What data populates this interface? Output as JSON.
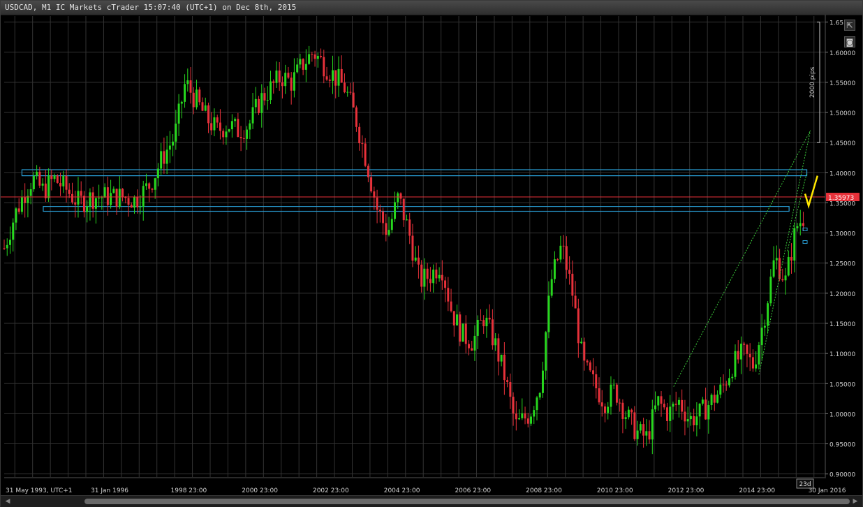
{
  "window": {
    "title": "USDCAD, M1 IC Markets cTrader 15:07:40 (UTC+1) on Dec 8th, 2015"
  },
  "toolbar": {
    "expand_icon": "expand-icon",
    "screenshot_icon": "camera-icon"
  },
  "chart_data": {
    "type": "candlestick",
    "title": "USDCAD, M1 IC Markets cTrader 15:07:40 (UTC+1) on Dec 8th, 2015",
    "ylim": [
      0.895,
      1.66
    ],
    "grid": true,
    "y_ticks": [
      "0.90000",
      "0.95000",
      "1.00000",
      "1.05000",
      "1.10000",
      "1.15000",
      "1.20000",
      "1.25000",
      "1.30000",
      "1.35000",
      "1.40000",
      "1.45000",
      "1.50000",
      "1.55000",
      "1.60000",
      "1.65"
    ],
    "x_ticks": [
      "31 May 1993, UTC+1",
      "31 Jan 1996",
      "1998 23:00",
      "2000 23:00",
      "2002 23:00",
      "2004 23:00",
      "2006 23:00",
      "2008 23:00",
      "2010 23:00",
      "2012 23:00",
      "2014 23:00",
      "30 Jan 2016"
    ],
    "current_price": {
      "label": "1.35973",
      "value": 1.35973,
      "color": "#e8313a"
    },
    "pip_ruler": {
      "label": "2000 pips",
      "from": 1.45,
      "to": 1.65
    },
    "period_label": "23d",
    "colors": {
      "up": "#27d81e",
      "down": "#e8313a",
      "zone": "#2a9fd6",
      "channel": "#3ccf3c",
      "projection": "#ffe600",
      "grid": "#333333",
      "axis_text": "#cfcfcf"
    },
    "zones": [
      {
        "start": "1993.9",
        "end": "2016.0",
        "top": 1.405,
        "bottom": 1.395
      },
      {
        "start": "1994.5",
        "end": "2015.5",
        "top": 1.344,
        "bottom": 1.336
      }
    ],
    "price_path": [
      [
        "1993.4",
        1.275
      ],
      [
        "1993.7",
        1.33
      ],
      [
        "1994.0",
        1.37
      ],
      [
        "1994.2",
        1.39
      ],
      [
        "1994.5",
        1.37
      ],
      [
        "1994.8",
        1.39
      ],
      [
        "1995.1",
        1.375
      ],
      [
        "1995.5",
        1.35
      ],
      [
        "1995.9",
        1.36
      ],
      [
        "1996.3",
        1.36
      ],
      [
        "1996.7",
        1.36
      ],
      [
        "1997.1",
        1.355
      ],
      [
        "1997.5",
        1.38
      ],
      [
        "1997.9",
        1.43
      ],
      [
        "1998.2",
        1.46
      ],
      [
        "1998.5",
        1.55
      ],
      [
        "1998.8",
        1.52
      ],
      [
        "1999.1",
        1.49
      ],
      [
        "1999.4",
        1.47
      ],
      [
        "1999.7",
        1.48
      ],
      [
        "2000.0",
        1.47
      ],
      [
        "2000.3",
        1.48
      ],
      [
        "2000.6",
        1.52
      ],
      [
        "2000.9",
        1.54
      ],
      [
        "2001.2",
        1.56
      ],
      [
        "2001.5",
        1.55
      ],
      [
        "2001.8",
        1.58
      ],
      [
        "2002.1",
        1.6
      ],
      [
        "2002.4",
        1.58
      ],
      [
        "2002.7",
        1.56
      ],
      [
        "2003.0",
        1.54
      ],
      [
        "2003.3",
        1.49
      ],
      [
        "2003.6",
        1.42
      ],
      [
        "2003.9",
        1.34
      ],
      [
        "2004.2",
        1.3
      ],
      [
        "2004.5",
        1.36
      ],
      [
        "2004.8",
        1.3
      ],
      [
        "2005.1",
        1.22
      ],
      [
        "2005.4",
        1.23
      ],
      [
        "2005.7",
        1.25
      ],
      [
        "2006.0",
        1.17
      ],
      [
        "2006.3",
        1.13
      ],
      [
        "2006.6",
        1.12
      ],
      [
        "2006.9",
        1.16
      ],
      [
        "2007.2",
        1.12
      ],
      [
        "2007.5",
        1.06
      ],
      [
        "2007.8",
        0.98
      ],
      [
        "2008.2",
        1.0
      ],
      [
        "2008.5",
        1.05
      ],
      [
        "2008.8",
        1.22
      ],
      [
        "2009.1",
        1.28
      ],
      [
        "2009.4",
        1.2
      ],
      [
        "2009.7",
        1.08
      ],
      [
        "2010.0",
        1.05
      ],
      [
        "2010.3",
        1.02
      ],
      [
        "2010.6",
        1.04
      ],
      [
        "2010.9",
        1.0
      ],
      [
        "2011.2",
        0.97
      ],
      [
        "2011.5",
        0.96
      ],
      [
        "2011.8",
        1.02
      ],
      [
        "2012.1",
        1.0
      ],
      [
        "2012.4",
        1.02
      ],
      [
        "2012.7",
        0.99
      ],
      [
        "2013.0",
        1.0
      ],
      [
        "2013.3",
        1.02
      ],
      [
        "2013.6",
        1.04
      ],
      [
        "2013.9",
        1.08
      ],
      [
        "2014.2",
        1.1
      ],
      [
        "2014.5",
        1.08
      ],
      [
        "2014.8",
        1.16
      ],
      [
        "2015.1",
        1.26
      ],
      [
        "2015.4",
        1.22
      ],
      [
        "2015.7",
        1.31
      ],
      [
        "2015.95",
        1.33
      ]
    ],
    "channel_lines": [
      {
        "start": [
          "2012.25",
          1.045
        ],
        "end": [
          "2016.1",
          1.47
        ]
      },
      {
        "start": [
          "2014.65",
          1.065
        ],
        "end": [
          "2016.1",
          1.47
        ]
      },
      {
        "start": [
          "2015.45",
          1.27
        ],
        "end": [
          "2016.0",
          1.4
        ]
      }
    ],
    "projection": [
      [
        "2015.95",
        1.365
      ],
      [
        "2016.05",
        1.345
      ],
      [
        "2016.3",
        1.395
      ]
    ],
    "markers": [
      {
        "x": "2015.95",
        "value": 1.285
      },
      {
        "x": "2015.95",
        "value": 1.306
      }
    ]
  }
}
